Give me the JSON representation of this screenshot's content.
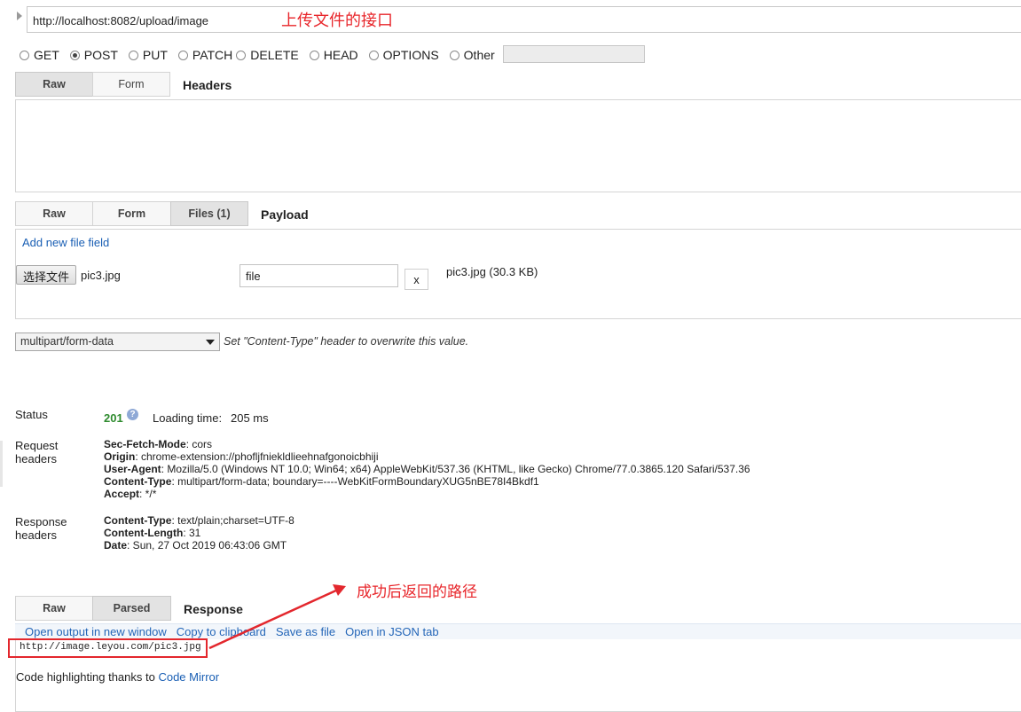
{
  "url": {
    "value": "http://localhost:8082/upload/image",
    "annotation": "上传文件的接口"
  },
  "methods": [
    {
      "label": "GET",
      "checked": false
    },
    {
      "label": "POST",
      "checked": true
    },
    {
      "label": "PUT",
      "checked": false
    },
    {
      "label": "PATCH",
      "checked": false
    },
    {
      "label": "DELETE",
      "checked": false
    },
    {
      "label": "HEAD",
      "checked": false
    },
    {
      "label": "OPTIONS",
      "checked": false
    },
    {
      "label": "Other",
      "checked": false
    }
  ],
  "headers_section": {
    "tabs": [
      "Raw",
      "Form"
    ],
    "active": "Raw",
    "title": "Headers"
  },
  "payload_section": {
    "tabs": [
      "Raw",
      "Form",
      "Files (1)"
    ],
    "active": "Files (1)",
    "title": "Payload",
    "add_link": "Add new file field",
    "choose_button": "选择文件",
    "chosen_file": "pic3.jpg",
    "field_name": "file",
    "remove_button": "x",
    "file_info": "pic3.jpg (30.3 KB)"
  },
  "content_type": {
    "selected": "multipart/form-data",
    "hint": "Set \"Content-Type\" header to overwrite this value."
  },
  "status": {
    "label": "Status",
    "code": "201",
    "help_icon": "?",
    "loading_label": "Loading time:",
    "loading_value": "205 ms"
  },
  "request_headers": {
    "label_line1": "Request",
    "label_line2": "headers",
    "items": [
      {
        "key": "Sec-Fetch-Mode",
        "value": ": cors"
      },
      {
        "key": "Origin",
        "value": ": chrome-extension://phofljfniekldlieehnafgonoicbhiji"
      },
      {
        "key": "User-Agent",
        "value": ": Mozilla/5.0 (Windows NT 10.0; Win64; x64) AppleWebKit/537.36 (KHTML, like Gecko) Chrome/77.0.3865.120 Safari/537.36"
      },
      {
        "key": "Content-Type",
        "value": ": multipart/form-data; boundary=----WebKitFormBoundaryXUG5nBE78I4Bkdf1"
      },
      {
        "key": "Accept",
        "value": ": */*"
      }
    ]
  },
  "response_headers": {
    "label_line1": "Response",
    "label_line2": "headers",
    "items": [
      {
        "key": "Content-Type",
        "value": ": text/plain;charset=UTF-8"
      },
      {
        "key": "Content-Length",
        "value": ": 31"
      },
      {
        "key": "Date",
        "value": ": Sun, 27 Oct 2019 06:43:06 GMT"
      }
    ]
  },
  "response": {
    "tabs": [
      "Raw",
      "Parsed"
    ],
    "active": "Parsed",
    "title": "Response",
    "links": [
      "Open output in new window",
      "Copy to clipboard",
      "Save as file",
      "Open in JSON tab"
    ],
    "body": "http://image.leyou.com/pic3.jpg",
    "annotation": "成功后返回的路径",
    "footer_text": "Code highlighting thanks to ",
    "footer_link": "Code Mirror"
  },
  "colors": {
    "annotation": "#e8252a",
    "link": "#1a5fb4",
    "status_ok": "#2e8b2e"
  }
}
